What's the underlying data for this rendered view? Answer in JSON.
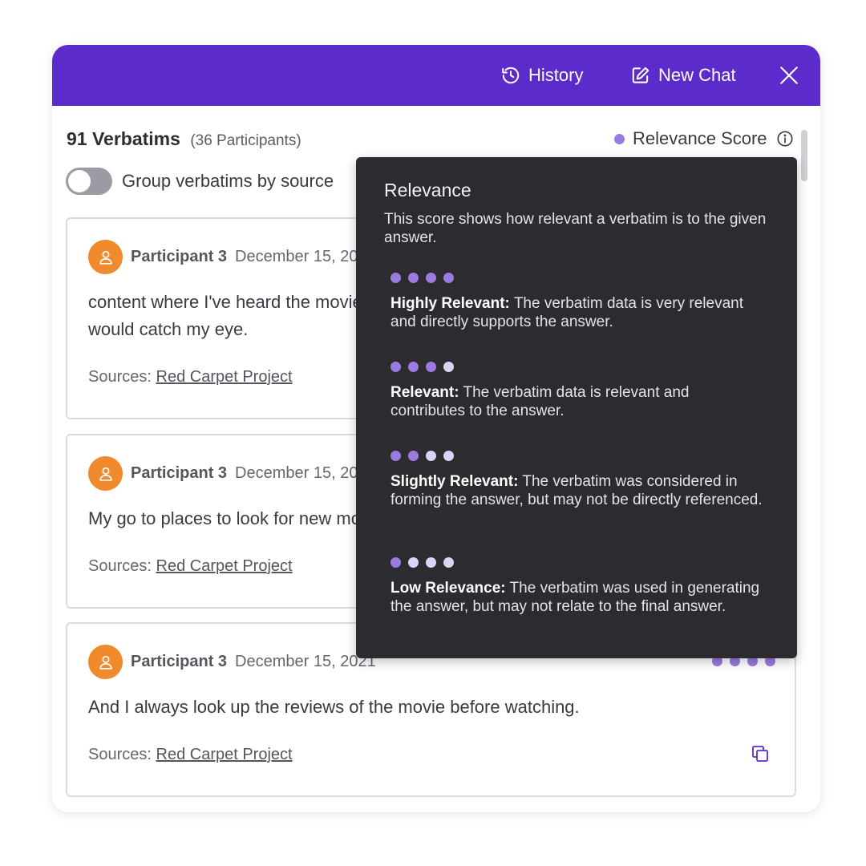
{
  "header": {
    "history_label": "History",
    "new_chat_label": "New Chat",
    "background_color": "#5b2bcb"
  },
  "summary": {
    "count_label": "91 Verbatims",
    "participants_label": "(36 Participants)",
    "relevance_label": "Relevance Score"
  },
  "group_toggle": {
    "label": "Group verbatims by source",
    "enabled": false
  },
  "cards": [
    {
      "participant": "Participant 3",
      "date": "December 15, 2021",
      "text_lines": [
        "content where I've heard the movie",
        "would catch my eye."
      ],
      "sources_label": "Sources:",
      "source_link": "Red Carpet Project"
    },
    {
      "participant": "Participant 3",
      "date": "December 15, 2021",
      "text_lines": [
        "My go to places to look for new movies"
      ],
      "sources_label": "Sources:",
      "source_link": "Red Carpet Project"
    },
    {
      "participant": "Participant 3",
      "date": "December 15, 2021",
      "text_lines": [
        "And I always look up the reviews of the movie before watching."
      ],
      "sources_label": "Sources:",
      "source_link": "Red Carpet Project",
      "relevance_dots": 4
    }
  ],
  "tooltip": {
    "title": "Relevance",
    "description": "This score shows how relevant a verbatim is to the given answer.",
    "levels": [
      {
        "filled": 4,
        "name": "Highly Relevant:",
        "text": "The verbatim data is very relevant and directly supports the answer."
      },
      {
        "filled": 3,
        "name": "Relevant:",
        "text": "The verbatim data is relevant and contributes to the answer."
      },
      {
        "filled": 2,
        "name": "Slightly Relevant:",
        "text": "The verbatim was considered in forming the answer, but may not be directly referenced."
      },
      {
        "filled": 1,
        "name": "Low Relevance:",
        "text": "The verbatim was used in generating the answer, but may not relate to the final answer."
      }
    ]
  },
  "colors": {
    "accent": "#5b2bcb",
    "score_filled": "#9b7be0",
    "score_empty": "#ddd3f7",
    "avatar": "#f08a2c",
    "tooltip_bg": "#2c2b2f"
  },
  "icons": {
    "history": "history-icon",
    "new_chat": "edit-icon",
    "close": "close-icon",
    "info": "info-icon",
    "avatar": "user-icon",
    "copy": "copy-icon"
  }
}
